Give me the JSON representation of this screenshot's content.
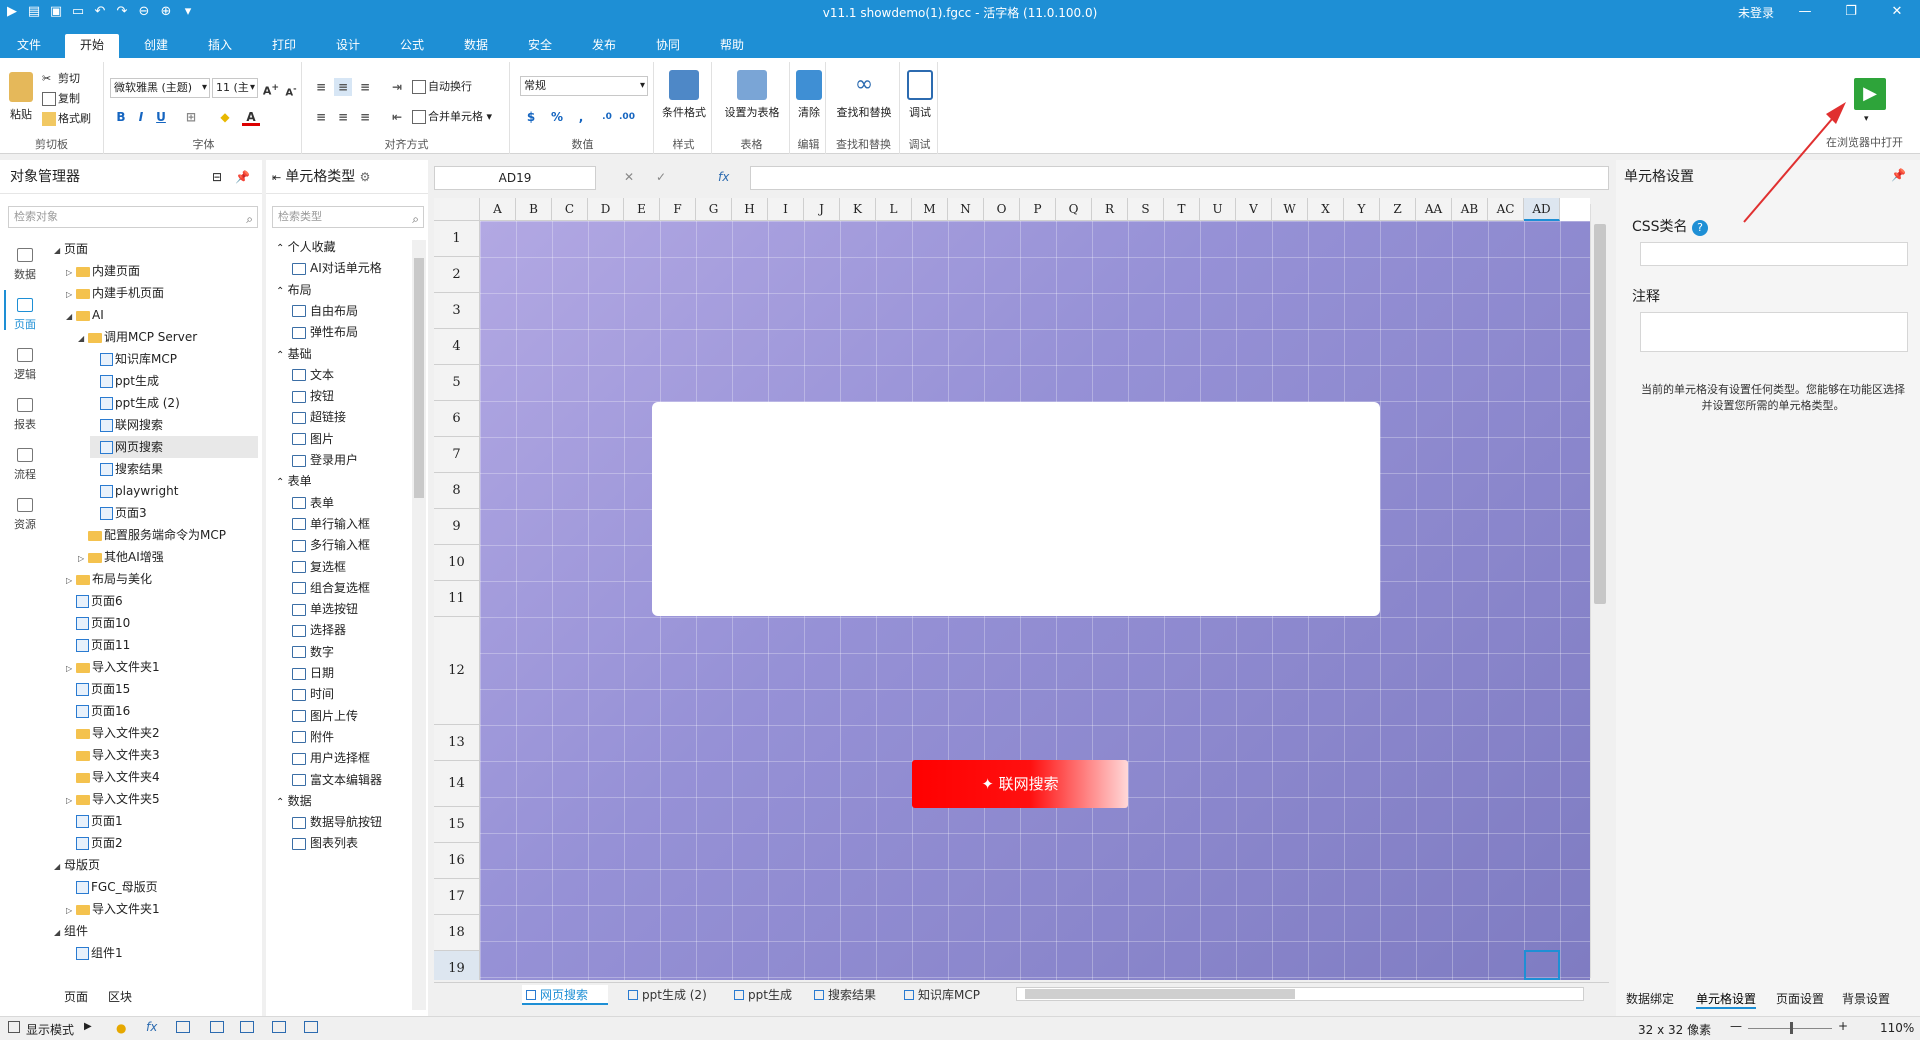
{
  "titlebar": {
    "title": "v11.1 showdemo(1).fgcc - 活字格 (11.0.100.0)",
    "login": "未登录",
    "min": "—",
    "max": "❐",
    "close": "✕"
  },
  "menu": {
    "tabs": [
      "文件",
      "开始",
      "创建",
      "插入",
      "打印",
      "设计",
      "公式",
      "数据",
      "安全",
      "发布",
      "协同",
      "帮助"
    ],
    "active": 1
  },
  "ribbon": {
    "clipboard": {
      "paste": "粘贴",
      "cut": "剪切",
      "copy": "复制",
      "format_painter": "格式刷",
      "label": "剪切板"
    },
    "font": {
      "family": "微软雅黑 (主题)",
      "size": "11 (主",
      "bold": "B",
      "italic": "I",
      "underline": "U",
      "label": "字体"
    },
    "align": {
      "wrap": "自动换行",
      "merge": "合并单元格",
      "label": "对齐方式"
    },
    "number": {
      "format": "常规",
      "currency": "$",
      "percent": "%",
      "comma": ",",
      "label": "数值"
    },
    "style": {
      "cond": "条件格式",
      "label": "样式"
    },
    "table": {
      "set": "设置为表格",
      "label": "表格"
    },
    "edit": {
      "clear": "清除",
      "label": "编辑"
    },
    "find": {
      "findreplace": "查找和替换",
      "label": "查找和替换"
    },
    "debug": {
      "debug": "调试",
      "label": "调试"
    },
    "run": {
      "label": "在浏览器中打开"
    }
  },
  "left_panel": {
    "title": "对象管理器",
    "search_placeholder": "检索对象",
    "nav": [
      "数据",
      "页面",
      "逻辑",
      "报表",
      "流程",
      "资源"
    ],
    "tree": [
      {
        "label": "页面",
        "d": 0,
        "t": "tri",
        "k": "none"
      },
      {
        "label": "内建页面",
        "d": 1,
        "t": "closed",
        "k": "folder"
      },
      {
        "label": "内建手机页面",
        "d": 1,
        "t": "closed",
        "k": "folder"
      },
      {
        "label": "AI",
        "d": 1,
        "t": "open",
        "k": "folder"
      },
      {
        "label": "调用MCP Server",
        "d": 2,
        "t": "open",
        "k": "folder"
      },
      {
        "label": "知识库MCP",
        "d": 3,
        "t": "",
        "k": "page"
      },
      {
        "label": "ppt生成",
        "d": 3,
        "t": "",
        "k": "page"
      },
      {
        "label": "ppt生成 (2)",
        "d": 3,
        "t": "",
        "k": "page"
      },
      {
        "label": "联网搜索",
        "d": 3,
        "t": "",
        "k": "page"
      },
      {
        "label": "网页搜索",
        "d": 3,
        "t": "",
        "k": "page",
        "sel": true
      },
      {
        "label": "搜索结果",
        "d": 3,
        "t": "",
        "k": "page"
      },
      {
        "label": "playwright",
        "d": 3,
        "t": "",
        "k": "page"
      },
      {
        "label": "页面3",
        "d": 3,
        "t": "",
        "k": "page"
      },
      {
        "label": "配置服务端命令为MCP",
        "d": 2,
        "t": "",
        "k": "folder"
      },
      {
        "label": "其他AI增强",
        "d": 2,
        "t": "closed",
        "k": "folder"
      },
      {
        "label": "布局与美化",
        "d": 1,
        "t": "closed",
        "k": "folder"
      },
      {
        "label": "页面6",
        "d": 1,
        "t": "",
        "k": "page"
      },
      {
        "label": "页面10",
        "d": 1,
        "t": "",
        "k": "page"
      },
      {
        "label": "页面11",
        "d": 1,
        "t": "",
        "k": "page"
      },
      {
        "label": "导入文件夹1",
        "d": 1,
        "t": "closed",
        "k": "folder"
      },
      {
        "label": "页面15",
        "d": 1,
        "t": "",
        "k": "page"
      },
      {
        "label": "页面16",
        "d": 1,
        "t": "",
        "k": "page"
      },
      {
        "label": "导入文件夹2",
        "d": 1,
        "t": "",
        "k": "folder"
      },
      {
        "label": "导入文件夹3",
        "d": 1,
        "t": "",
        "k": "folder"
      },
      {
        "label": "导入文件夹4",
        "d": 1,
        "t": "",
        "k": "folder"
      },
      {
        "label": "导入文件夹5",
        "d": 1,
        "t": "closed",
        "k": "folder"
      },
      {
        "label": "页面1",
        "d": 1,
        "t": "",
        "k": "page"
      },
      {
        "label": "页面2",
        "d": 1,
        "t": "",
        "k": "page"
      },
      {
        "label": "母版页",
        "d": 0,
        "t": "tri",
        "k": "none"
      },
      {
        "label": "FGC_母版页",
        "d": 1,
        "t": "",
        "k": "page"
      },
      {
        "label": "导入文件夹1",
        "d": 1,
        "t": "closed",
        "k": "folder"
      },
      {
        "label": "组件",
        "d": 0,
        "t": "tri",
        "k": "none"
      },
      {
        "label": "组件1",
        "d": 1,
        "t": "",
        "k": "page"
      }
    ],
    "bottom_tabs": [
      "页面",
      "区块"
    ]
  },
  "cell_types": {
    "title": "单元格类型",
    "search_placeholder": "检索类型",
    "items": [
      {
        "label": "个人收藏",
        "h": true
      },
      {
        "label": "AI对话单元格"
      },
      {
        "label": "布局",
        "h": true
      },
      {
        "label": "自由布局"
      },
      {
        "label": "弹性布局"
      },
      {
        "label": "基础",
        "h": true
      },
      {
        "label": "文本"
      },
      {
        "label": "按钮"
      },
      {
        "label": "超链接"
      },
      {
        "label": "图片"
      },
      {
        "label": "登录用户"
      },
      {
        "label": "表单",
        "h": true
      },
      {
        "label": "表单"
      },
      {
        "label": "单行输入框"
      },
      {
        "label": "多行输入框"
      },
      {
        "label": "复选框"
      },
      {
        "label": "组合复选框"
      },
      {
        "label": "单选按钮"
      },
      {
        "label": "选择器"
      },
      {
        "label": "数字"
      },
      {
        "label": "日期"
      },
      {
        "label": "时间"
      },
      {
        "label": "图片上传"
      },
      {
        "label": "附件"
      },
      {
        "label": "用户选择框"
      },
      {
        "label": "富文本编辑器"
      },
      {
        "label": "数据",
        "h": true
      },
      {
        "label": "数据导航按钮"
      },
      {
        "label": "图表列表"
      }
    ]
  },
  "formula_bar": {
    "name_box": "AD19",
    "cancel": "✕",
    "confirm": "✓",
    "fx": "fx"
  },
  "sheet": {
    "columns": [
      "A",
      "B",
      "C",
      "D",
      "E",
      "F",
      "G",
      "H",
      "I",
      "J",
      "K",
      "L",
      "M",
      "N",
      "O",
      "P",
      "Q",
      "R",
      "S",
      "T",
      "U",
      "V",
      "W",
      "X",
      "Y",
      "Z",
      "AA",
      "AB",
      "AC",
      "AD"
    ],
    "rows": [
      "1",
      "2",
      "3",
      "4",
      "5",
      "6",
      "7",
      "8",
      "9",
      "10",
      "11",
      "12",
      "13",
      "14",
      "15",
      "16",
      "17",
      "18",
      "19"
    ],
    "button_label": "✦ 联网搜索"
  },
  "sheet_tabs": [
    "网页搜索",
    "ppt生成 (2)",
    "ppt生成",
    "搜索结果",
    "知识库MCP"
  ],
  "right_panel": {
    "title": "单元格设置",
    "css_label": "CSS类名",
    "note_label": "注释",
    "help": "?",
    "message": "当前的单元格没有设置任何类型。您能够在功能区选择并设置您所需的单元格类型。",
    "tabs": [
      "数据绑定",
      "单元格设置",
      "页面设置",
      "背景设置"
    ]
  },
  "statusbar": {
    "mode": "显示模式",
    "size": "32 x 32 像素",
    "zoom": "110%"
  }
}
